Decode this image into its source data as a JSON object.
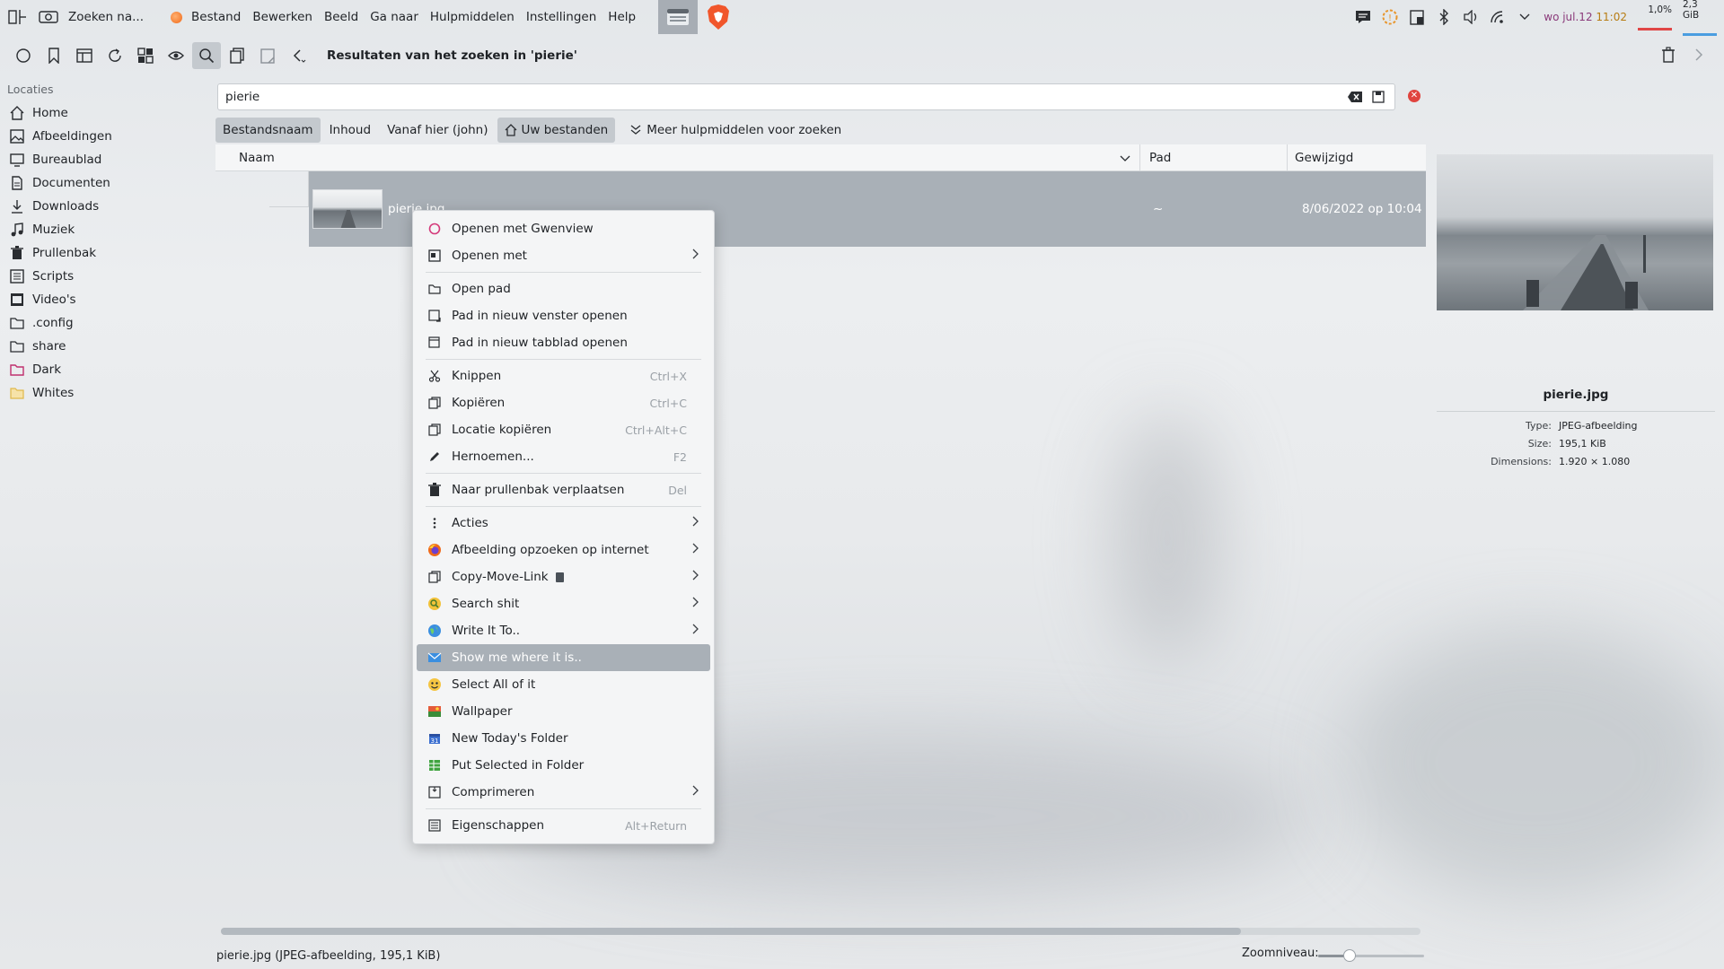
{
  "topbar": {
    "app_title": "Zoeken na...",
    "menu": [
      "Bestand",
      "Bewerken",
      "Beeld",
      "Ga naar",
      "Hulpmiddelen",
      "Instellingen",
      "Help"
    ],
    "clock_date": "wo jul.12",
    "clock_time": "11:02",
    "cpu": "1,0%",
    "mem": "2,3 GiB"
  },
  "toolbar": {
    "breadcrumb": "Resultaten van het zoeken in 'pierie'"
  },
  "sidebar": {
    "section": "Locaties",
    "places": [
      {
        "label": "Home",
        "icon": "home-icon"
      },
      {
        "label": "Afbeeldingen",
        "icon": "image-icon"
      },
      {
        "label": "Bureaublad",
        "icon": "desktop-icon"
      },
      {
        "label": "Documenten",
        "icon": "document-icon"
      },
      {
        "label": "Downloads",
        "icon": "download-icon"
      },
      {
        "label": "Muziek",
        "icon": "music-icon"
      },
      {
        "label": "Prullenbak",
        "icon": "trash-icon"
      },
      {
        "label": "Scripts",
        "icon": "list-icon"
      },
      {
        "label": "Video's",
        "icon": "video-icon"
      },
      {
        "label": ".config",
        "icon": "folder-icon"
      },
      {
        "label": "share",
        "icon": "folder-icon"
      },
      {
        "label": "Dark",
        "icon": "folder-pink-icon"
      },
      {
        "label": "Whites",
        "icon": "folder-yellow-icon"
      }
    ]
  },
  "search": {
    "value": "pierie"
  },
  "filters": {
    "filename": "Bestandsnaam",
    "content": "Inhoud",
    "from_here": "Vanaf hier (john)",
    "your_files": "Uw bestanden",
    "more_tools": "Meer hulpmiddelen voor zoeken"
  },
  "list": {
    "col_name": "Naam",
    "col_path": "Pad",
    "col_modified": "Gewijzigd",
    "row": {
      "name": "pierie.jpg",
      "path": "~",
      "modified": "8/06/2022 op 10:04"
    }
  },
  "preview": {
    "filename": "pierie.jpg",
    "type_label": "Type:",
    "type_value": "JPEG-afbeelding",
    "size_label": "Size:",
    "size_value": "195,1 KiB",
    "dim_label": "Dimensions:",
    "dim_value": "1.920 × 1.080"
  },
  "context_menu": {
    "items": [
      {
        "label": "Openen met Gwenview",
        "icon": "gwenview-icon"
      },
      {
        "label": "Openen met",
        "icon": "open-with-icon",
        "submenu": true
      },
      {
        "sep": true
      },
      {
        "label": "Open pad",
        "icon": "folder-open-icon"
      },
      {
        "label": "Pad in nieuw venster openen",
        "icon": "window-new-icon"
      },
      {
        "label": "Pad in nieuw tabblad openen",
        "icon": "tab-new-icon"
      },
      {
        "sep": true
      },
      {
        "label": "Knippen",
        "icon": "cut-icon",
        "shortcut": "Ctrl+X"
      },
      {
        "label": "Kopiëren",
        "icon": "copy-icon",
        "shortcut": "Ctrl+C"
      },
      {
        "label": "Locatie kopiëren",
        "icon": "copy-location-icon",
        "shortcut": "Ctrl+Alt+C"
      },
      {
        "label": "Hernoemen...",
        "icon": "rename-icon",
        "shortcut": "F2"
      },
      {
        "sep": true
      },
      {
        "label": "Naar prullenbak verplaatsen",
        "icon": "trash-icon",
        "shortcut": "Del"
      },
      {
        "sep": true
      },
      {
        "label": "Acties",
        "icon": "more-vertical-icon",
        "submenu": true
      },
      {
        "label": "Afbeelding opzoeken op internet",
        "icon": "firefox-icon",
        "submenu": true
      },
      {
        "label": "Copy-Move-Link",
        "icon": "copy-move-icon",
        "submenu": true,
        "badge": true
      },
      {
        "label": "Search shit",
        "icon": "search-shit-icon",
        "submenu": true
      },
      {
        "label": "Write It To..",
        "icon": "globe-icon",
        "submenu": true
      },
      {
        "label": "Show me where it is..",
        "icon": "mail-icon",
        "highlight": true
      },
      {
        "label": "Select All of it",
        "icon": "emoji-icon"
      },
      {
        "label": "Wallpaper",
        "icon": "wallpaper-icon"
      },
      {
        "label": "New Today's Folder",
        "icon": "calendar-icon"
      },
      {
        "label": "Put Selected in Folder",
        "icon": "spreadsheet-icon"
      },
      {
        "label": "Comprimeren",
        "icon": "compress-icon",
        "submenu": true
      },
      {
        "sep": true
      },
      {
        "label": "Eigenschappen",
        "icon": "properties-icon",
        "shortcut": "Alt+Return"
      }
    ]
  },
  "statusbar": {
    "text": "pierie.jpg (JPEG-afbeelding, 195,1 KiB)",
    "zoom_label": "Zoomniveau:",
    "zoom_level": 0.27
  },
  "colors": {
    "selection": "#a9b0b7",
    "accent_red": "#e0443e",
    "clock_time": "#b77c12"
  }
}
